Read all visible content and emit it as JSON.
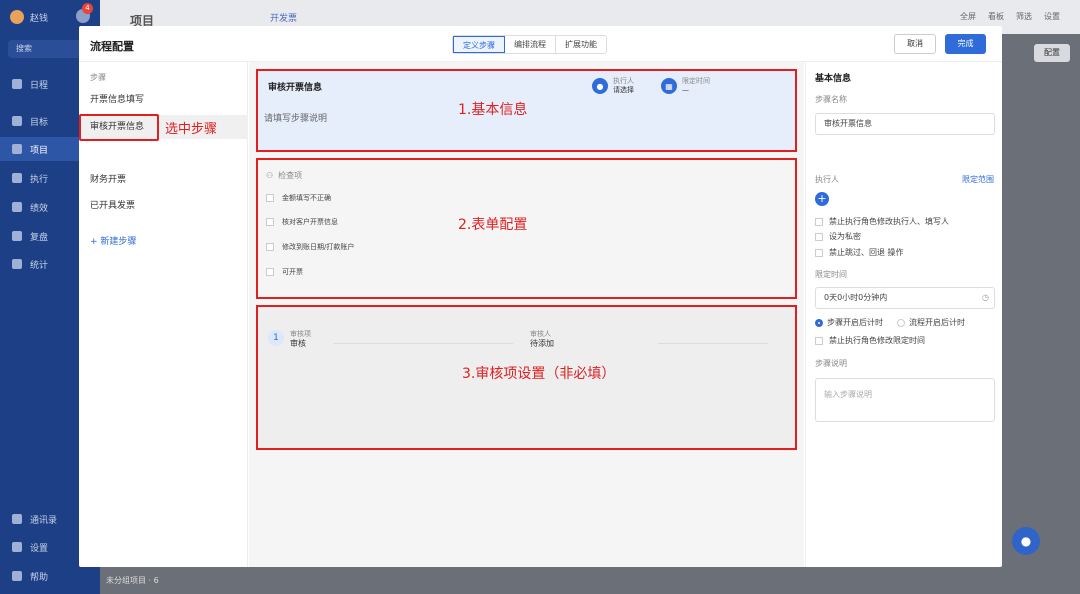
{
  "background": {
    "user_name": "赵钱",
    "badge_count": "4",
    "search": "搜索",
    "nav": [
      "日程",
      "目标",
      "项目",
      "执行",
      "绩效",
      "复盘",
      "统计"
    ],
    "nav_bottom": [
      "通讯录",
      "设置",
      "帮助"
    ],
    "header_title": "项目",
    "header_tab": "开发票",
    "tools": [
      "全屏",
      "看板",
      "筛选",
      "设置"
    ],
    "config_button": "配置",
    "ungrouped": "未分组项目 · 6"
  },
  "modal": {
    "title": "流程配置",
    "tabs": [
      "定义步骤",
      "编排流程",
      "扩展功能"
    ],
    "cancel": "取消",
    "done": "完成"
  },
  "steps": {
    "label": "步骤",
    "items": [
      "开票信息填写",
      "审核开票信息",
      "财务开票",
      "已开具发票"
    ],
    "add": "+ 新建步骤",
    "annotation": "选中步骤"
  },
  "basic_card": {
    "title": "审核开票信息",
    "desc": "请填写步骤说明",
    "executor_label": "执行人",
    "executor_value": "请选择",
    "time_label": "限定时间",
    "time_value": "—",
    "annotation": "1.基本信息"
  },
  "form_card": {
    "head": "检查项",
    "items": [
      "金额填写不正确",
      "核对客户开票信息",
      "修改到账日期/打款账户",
      "可开票"
    ],
    "annotation": "2.表单配置"
  },
  "review_card": {
    "num": "1",
    "item_label": "审核项",
    "item_value": "审核",
    "reviewer_label": "审核人",
    "reviewer_value": "待添加",
    "annotation": "3.审核项设置（非必填）"
  },
  "right_panel": {
    "title": "基本信息",
    "step_name_label": "步骤名称",
    "step_name_value": "审核开票信息",
    "executor_label": "执行人",
    "executor_link": "限定范围",
    "checks": [
      "禁止执行角色修改执行人、填写人",
      "设为私密",
      "禁止跳过、回退 操作"
    ],
    "time_label": "限定时间",
    "time_value": "0天0小时0分钟内",
    "radio_step": "步骤开启后计时",
    "radio_flow": "流程开启后计时",
    "time_check": "禁止执行角色修改限定时间",
    "desc_label": "步骤说明",
    "desc_placeholder": "输入步骤说明"
  }
}
